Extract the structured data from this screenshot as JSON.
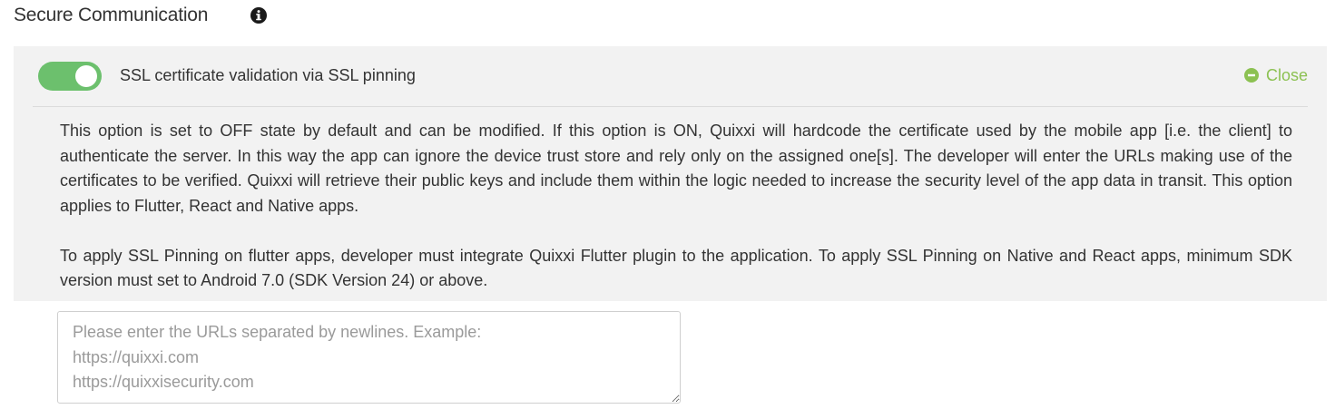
{
  "section": {
    "title": "Secure Communication"
  },
  "option": {
    "toggle_state": "on",
    "label": "SSL certificate validation via SSL pinning",
    "close_label": "Close",
    "description_paragraphs": [
      "This option is set to OFF state by default and can be modified. If this option is ON, Quixxi will hardcode the certificate used by the mobile app [i.e. the client] to authenticate the server. In this way the app can ignore the device trust store and rely only on the assigned one[s]. The developer will enter the URLs making use of the certificates to be verified. Quixxi will retrieve their public keys and include them within the logic needed to increase the security level of the app data in transit. This option applies to Flutter, React and Native apps.",
      "To apply SSL Pinning on flutter apps, developer must integrate Quixxi Flutter plugin to the application. To apply SSL Pinning on Native and React apps, minimum SDK version must set to Android 7.0 (SDK Version 24) or above."
    ]
  },
  "url_input": {
    "value": "",
    "placeholder": "Please enter the URLs separated by newlines. Example:\nhttps://quixxi.com\nhttps://quixxisecurity.com"
  },
  "icons": {
    "info": "info-circle-icon",
    "close": "minus-circle-icon"
  },
  "colors": {
    "toggle_on": "#6cc06d",
    "close_link": "#8cc152",
    "panel_bg": "#f2f2f2",
    "text": "#333333",
    "placeholder": "#9a9a9a"
  }
}
